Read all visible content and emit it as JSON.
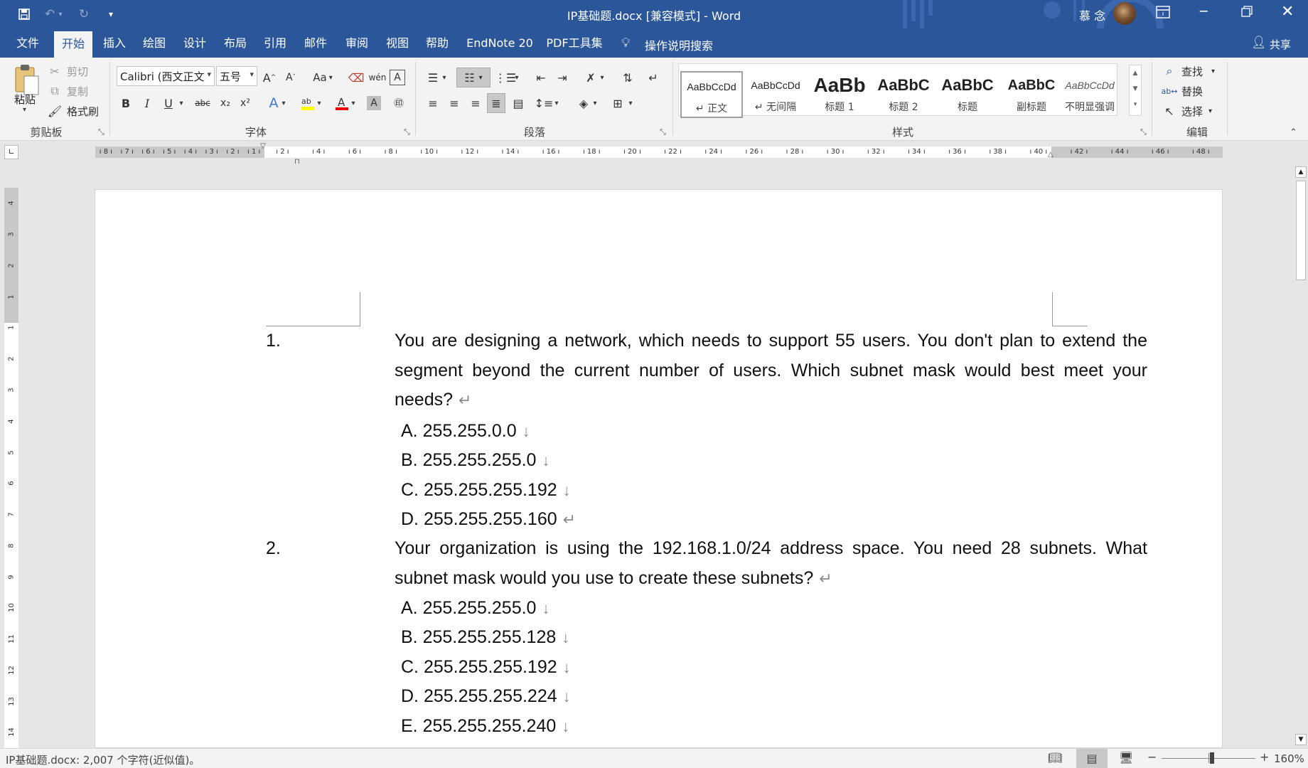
{
  "titlebar": {
    "doc_title": "IP基础题.docx [兼容模式]  -  Word",
    "user_name": "慕 念",
    "qat": {
      "save": "save-icon",
      "undo": "undo-icon",
      "redo": "redo-icon",
      "customize": "customize-qat-icon"
    }
  },
  "tabs": [
    "文件",
    "开始",
    "插入",
    "绘图",
    "设计",
    "布局",
    "引用",
    "邮件",
    "审阅",
    "视图",
    "帮助",
    "EndNote 20",
    "PDF工具集"
  ],
  "active_tab": "开始",
  "tell_me": "操作说明搜索",
  "share": "共享",
  "ribbon": {
    "clipboard": {
      "paste": "粘贴",
      "cut": "剪切",
      "copy": "复制",
      "format_painter": "格式刷",
      "label": "剪贴板"
    },
    "font": {
      "name": "Calibri (西文正文",
      "size": "五号",
      "label": "字体",
      "aa": "Aa",
      "bold": "B",
      "italic": "I",
      "underline": "U",
      "strike": "abc",
      "sub": "x₂",
      "sup": "x²",
      "grow": "A",
      "shrink": "A"
    },
    "paragraph": {
      "label": "段落"
    },
    "styles": {
      "label": "样式",
      "items": [
        {
          "preview": "AaBbCcDd",
          "name": "↵ 正文"
        },
        {
          "preview": "AaBbCcDd",
          "name": "↵ 无间隔"
        },
        {
          "preview": "AaBb",
          "name": "标题 1"
        },
        {
          "preview": "AaBbC",
          "name": "标题 2"
        },
        {
          "preview": "AaBbC",
          "name": "标题"
        },
        {
          "preview": "AaBbC",
          "name": "副标题"
        },
        {
          "preview": "AaBbCcDd",
          "name": "不明显强调"
        }
      ]
    },
    "editing": {
      "find": "查找",
      "replace": "替换",
      "select": "选择",
      "label": "编辑"
    }
  },
  "ruler": {
    "left_ticks": [
      "8",
      "7",
      "6",
      "5",
      "4",
      "3",
      "2",
      "1"
    ],
    "right_ticks": [
      "2",
      "4",
      "6",
      "8",
      "10",
      "12",
      "14",
      "16",
      "18",
      "20",
      "22",
      "24",
      "26",
      "28",
      "30",
      "32",
      "34",
      "36",
      "38",
      "40",
      "42",
      "44",
      "46",
      "48"
    ],
    "vertical_ticks": [
      "4",
      "3",
      "2",
      "1",
      "1",
      "2",
      "3",
      "4",
      "5",
      "6",
      "7",
      "8",
      "9",
      "10",
      "11",
      "12",
      "13",
      "14"
    ]
  },
  "document": {
    "q1": {
      "number": "1.",
      "text": "You are designing a network, which needs to support 55 users. You don't plan to extend the segment beyond the current number of users. Which subnet mask would best meet your needs?",
      "options": [
        "A. 255.255.0.0",
        "B. 255.255.255.0",
        "C. 255.255.255.192",
        "D. 255.255.255.160"
      ]
    },
    "q2": {
      "number": "2.",
      "text": "Your organization is using the 192.168.1.0/24 address space. You need 28 subnets. What subnet mask would you use to create these subnets?",
      "options": [
        "A. 255.255.255.0",
        "B. 255.255.255.128",
        "C. 255.255.255.192",
        "D. 255.255.255.224",
        "E. 255.255.255.240"
      ]
    },
    "para_mark": "↵",
    "line_break": "↓"
  },
  "statusbar": {
    "doc_stats": "IP基础题.docx: 2,007 个字符(近似值)。",
    "zoom": "160%"
  },
  "colors": {
    "brand": "#2b579a",
    "ribbon_bg": "#f3f3f3"
  }
}
